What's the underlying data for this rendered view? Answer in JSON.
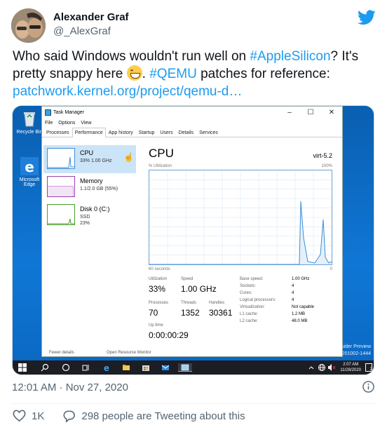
{
  "tweet": {
    "author_name": "Alexander Graf",
    "author_handle": "@_AlexGraf",
    "text_part1": "Who said Windows wouldn't run well on ",
    "tag1": "#AppleSilicon",
    "text_part2": "? It's pretty snappy here ",
    "text_part3": ". ",
    "tag2": "#QEMU",
    "text_part4": " patches for reference:",
    "link": "patchwork.kernel.org/project/qemu-d…",
    "timestamp": "12:01 AM · Nov 27, 2020",
    "likes": "1K",
    "retweet_text": "298 people are Tweeting about this",
    "accent_color": "#1d9bf0"
  },
  "desktop": {
    "icons": [
      {
        "label": "Recycle Bin",
        "icon": "recycle-bin-icon"
      },
      {
        "label": "Microsoft Edge",
        "icon": "edge-icon"
      }
    ],
    "watermark_1": "sider Preview",
    "watermark_2": "-201002-1444"
  },
  "task_manager": {
    "title": "Task Manager",
    "menu": [
      "File",
      "Options",
      "View"
    ],
    "tabs": [
      "Processes",
      "Performance",
      "App history",
      "Startup",
      "Users",
      "Details",
      "Services"
    ],
    "active_tab": "Performance",
    "resources": [
      {
        "name": "CPU",
        "sub": "33% 1.00 GHz",
        "color": "#3b8ed8"
      },
      {
        "name": "Memory",
        "sub": "1.1/2.0 GB (55%)",
        "color": "#9b3fae"
      },
      {
        "name": "Disk 0 (C:)",
        "sub": "SSD\n23%",
        "color": "#4aa02c"
      }
    ],
    "cpu": {
      "heading": "CPU",
      "model": "virt-5.2",
      "util_label": "% Utilization",
      "max_label": "100%",
      "time_label": "60 seconds",
      "min_label": "0",
      "utilization_label": "Utilization",
      "utilization": "33%",
      "speed_label": "Speed",
      "speed": "1.00 GHz",
      "processes_label": "Processes",
      "processes": "70",
      "threads_label": "Threads",
      "threads": "1352",
      "handles_label": "Handles",
      "handles": "30361",
      "uptime_label": "Up time",
      "uptime": "0:00:00:29",
      "specs": [
        {
          "label": "Base speed:",
          "value": "1.00 GHz"
        },
        {
          "label": "Sockets:",
          "value": "4"
        },
        {
          "label": "Cores:",
          "value": "4"
        },
        {
          "label": "Logical processors:",
          "value": "4"
        },
        {
          "label": "Virtualization:",
          "value": "Not capable"
        },
        {
          "label": "L1 cache:",
          "value": "1.2 MB"
        },
        {
          "label": "L2 cache:",
          "value": "48.0 MB"
        }
      ]
    }
  },
  "taskbar": {
    "time": "2:07 AM",
    "date": "11/28/2020",
    "notif_count": "2",
    "tray_labels": [
      "Fewer details",
      "Open Resource Monitor"
    ]
  }
}
